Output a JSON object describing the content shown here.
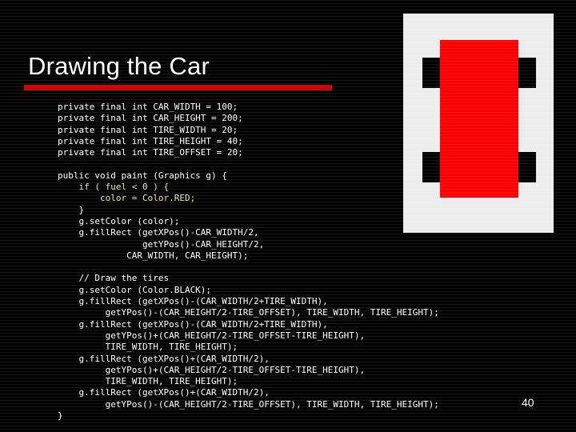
{
  "slide": {
    "title": "Drawing the Car",
    "page_number": "40",
    "background_color": "#000000",
    "accent_color": "#cc0000",
    "text_color": "#ffffff",
    "highlight_color": "#e8e8a0"
  },
  "code": {
    "language": "java",
    "lines": [
      {
        "text": "private final int CAR_WIDTH = 100;",
        "highlight": false
      },
      {
        "text": "private final int CAR_HEIGHT = 200;",
        "highlight": false
      },
      {
        "text": "private final int TIRE_WIDTH = 20;",
        "highlight": false
      },
      {
        "text": "private final int TIRE_HEIGHT = 40;",
        "highlight": false
      },
      {
        "text": "private final int TIRE_OFFSET = 20;",
        "highlight": false
      },
      {
        "text": "",
        "highlight": false
      },
      {
        "text": "public void paint (Graphics g) {",
        "highlight": false
      },
      {
        "text": "    if ( fuel < 0 ) {",
        "highlight": true
      },
      {
        "text": "        color = Color.RED;",
        "highlight": true
      },
      {
        "text": "    }",
        "highlight": false
      },
      {
        "text": "    g.setColor (color);",
        "highlight": false
      },
      {
        "text": "    g.fillRect (getXPos()-CAR_WIDTH/2,",
        "highlight": false
      },
      {
        "text": "                getYPos()-CAR_HEIGHT/2,",
        "highlight": false
      },
      {
        "text": "             CAR_WIDTH, CAR_HEIGHT);",
        "highlight": false
      },
      {
        "text": "",
        "highlight": false
      },
      {
        "text": "    // Draw the tires",
        "highlight": false
      },
      {
        "text": "    g.setColor (Color.BLACK);",
        "highlight": false
      },
      {
        "text": "    g.fillRect (getXPos()-(CAR_WIDTH/2+TIRE_WIDTH),",
        "highlight": false
      },
      {
        "text": "         getYPos()-(CAR_HEIGHT/2-TIRE_OFFSET), TIRE_WIDTH, TIRE_HEIGHT);",
        "highlight": false
      },
      {
        "text": "    g.fillRect (getXPos()-(CAR_WIDTH/2+TIRE_WIDTH),",
        "highlight": false
      },
      {
        "text": "         getYPos()+(CAR_HEIGHT/2-TIRE_OFFSET-TIRE_HEIGHT),",
        "highlight": false
      },
      {
        "text": "         TIRE_WIDTH, TIRE_HEIGHT);",
        "highlight": false
      },
      {
        "text": "    g.fillRect (getXPos()+(CAR_WIDTH/2),",
        "highlight": false
      },
      {
        "text": "         getYPos()+(CAR_HEIGHT/2-TIRE_OFFSET-TIRE_HEIGHT),",
        "highlight": false
      },
      {
        "text": "         TIRE_WIDTH, TIRE_HEIGHT);",
        "highlight": false
      },
      {
        "text": "    g.fillRect (getXPos()+(CAR_WIDTH/2),",
        "highlight": false
      },
      {
        "text": "         getYPos()-(CAR_HEIGHT/2-TIRE_OFFSET), TIRE_WIDTH, TIRE_HEIGHT);",
        "highlight": false
      },
      {
        "text": "}",
        "highlight": false
      }
    ]
  },
  "diagram": {
    "panel_color": "#ececec",
    "body_color": "#ff0000",
    "tire_color": "#000000",
    "tires": [
      "front-left",
      "front-right",
      "rear-left",
      "rear-right"
    ]
  }
}
